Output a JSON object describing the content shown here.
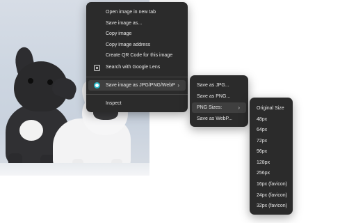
{
  "context_menu": {
    "items": [
      {
        "label": "Open image in new tab"
      },
      {
        "label": "Save image as..."
      },
      {
        "label": "Copy image"
      },
      {
        "label": "Copy image address"
      },
      {
        "label": "Create QR Code for this image"
      },
      {
        "label": "Search with Google Lens",
        "icon": "google-lens-icon"
      },
      {
        "label": "Save image as JPG/PNG/WebP",
        "icon": "extension-icon",
        "has_submenu": true,
        "submenu_arrow": "›"
      },
      {
        "label": "Inspect"
      }
    ]
  },
  "save_submenu": {
    "items": [
      {
        "label": "Save as JPG..."
      },
      {
        "label": "Save as PNG..."
      },
      {
        "label": "PNG Sizes:",
        "has_submenu": true,
        "submenu_arrow": "›"
      },
      {
        "label": "Save as WebP..."
      }
    ]
  },
  "png_sizes_submenu": {
    "items": [
      {
        "label": "Original Size"
      },
      {
        "label": "48px"
      },
      {
        "label": "64px"
      },
      {
        "label": "72px"
      },
      {
        "label": "96px"
      },
      {
        "label": "128px"
      },
      {
        "label": "256px"
      },
      {
        "label": "16px (favicon)"
      },
      {
        "label": "24px (favicon)"
      },
      {
        "label": "32px (favicon)"
      }
    ]
  },
  "colors": {
    "menu_background": "#2b2b2b",
    "menu_highlight": "#3f3f3f",
    "menu_text": "#e8e8e8",
    "extension_accent": "#29b8c9"
  }
}
